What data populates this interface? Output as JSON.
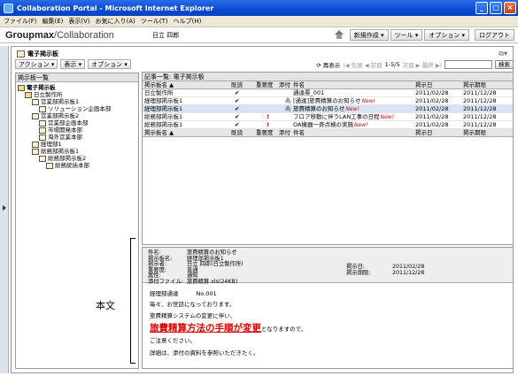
{
  "window": {
    "title": "Collaboration Portal - Microsoft Internet Explorer",
    "buttons": {
      "minimize": "_",
      "maximize": "□",
      "close": "×"
    }
  },
  "menubar": [
    "ファイル(F)",
    "編集(E)",
    "表示(V)",
    "お気に入り(A)",
    "ツール(T)",
    "ヘルプ(H)"
  ],
  "header": {
    "logo_bold": "Groupmax",
    "logo_rest": "/Collaboration",
    "company": "日立 四郎",
    "buttons": [
      "新規作成 ▾",
      "ツール ▾",
      "オプション ▾"
    ],
    "logout": "ログアウト"
  },
  "app": {
    "title": "電子掲示板",
    "toolbar": [
      "アクション ▾",
      "表示 ▾",
      "オプション ▾"
    ]
  },
  "tree": {
    "header": "掲示板一覧",
    "nodes": [
      {
        "label": "電子掲示板",
        "bold": true,
        "folder": true
      },
      {
        "label": "日立製作所",
        "folder": true
      },
      {
        "label": "営業部掲示板1"
      },
      {
        "label": "ソリューション企画本部"
      },
      {
        "label": "営業部掲示板2"
      },
      {
        "label": "営業部企画本部"
      },
      {
        "label": "市場開発本部"
      },
      {
        "label": "海外営業本部"
      },
      {
        "label": "経理部1"
      },
      {
        "label": "総務部掲示板1"
      },
      {
        "label": "総務部掲示板2"
      },
      {
        "label": "総務統括本部"
      }
    ]
  },
  "list_tools": {
    "refresh": "再表示",
    "nav": "|◀ 先頭 ◀ 前頁",
    "count": "1-5/5",
    "nav_next": "次頁 ▶ 最終 ▶|",
    "search_placeholder": "",
    "search_button": "検索"
  },
  "list": {
    "title": "記事一覧: 電子掲示板",
    "columns": [
      "掲示板名 ▲",
      "既読",
      "重要度",
      "添付",
      "件名",
      "掲示日",
      "掲示期限"
    ],
    "rows": [
      {
        "board": "日立製作所",
        "read": "✔",
        "important": "",
        "attach": "",
        "subject": "通達票_001",
        "new": "",
        "date": "2011/02/28",
        "expire": "2011/12/28"
      },
      {
        "board": "経理部掲示板1",
        "read": "✔",
        "important": "",
        "attach": "🖇",
        "subject": "[通達]旅費精算のお知らせ",
        "new": "New!",
        "date": "2011/02/28",
        "expire": "2011/12/28"
      },
      {
        "board": "経理部掲示板1",
        "read": "✔",
        "important": "",
        "attach": "🖇",
        "subject": "旅費精算のお知らせ",
        "new": "New!",
        "date": "2011/02/28",
        "expire": "2011/12/28"
      },
      {
        "board": "総務部掲示板1",
        "read": "✔",
        "important": "!",
        "attach": "",
        "subject": "フロア移動に伴うLAN工事の日程",
        "new": "New!",
        "date": "2011/02/28",
        "expire": "2011/12/28"
      },
      {
        "board": "総務部掲示板1",
        "read": "✔",
        "important": "!",
        "attach": "",
        "subject": "OA機器一斉点検の実施",
        "new": "New!",
        "date": "2011/02/28",
        "expire": "2011/12/28"
      }
    ],
    "footer_columns": [
      "掲示板名 ▲",
      "既読",
      "重要度",
      "添付",
      "件名",
      "掲示日",
      "掲示期限"
    ]
  },
  "detail": {
    "meta": [
      {
        "label": "件名:",
        "value": "旅費精算のお知らせ"
      },
      {
        "label": "掲示板名:",
        "value": "経理部掲示板1"
      },
      {
        "label": "掲示者:",
        "value": "日立 四郎(日立製作所)"
      },
      {
        "label": "重要度:",
        "value": "普通"
      },
      {
        "label": "属性:",
        "value": "通知"
      },
      {
        "label": "添付ファイル:",
        "value": "旅費精算.xls(24KB)"
      }
    ],
    "date_label": "掲示日:",
    "date_value": "2011/02/28",
    "expire_label": "掲示期限:",
    "expire_value": "2011/12/28",
    "body": {
      "line1a": "経理部通達",
      "line1b": "No.001",
      "line2": "毎々、お世話になっております。",
      "line3": "旅費精算システムの変更に伴い、",
      "line4_big": "旅費精算方法の手順が変更",
      "line4_rest": "となりますので、",
      "line5": "ご注意ください。",
      "line6": "詳細は、添付の資料を参照いただきたく。"
    }
  },
  "annotation": "本文"
}
